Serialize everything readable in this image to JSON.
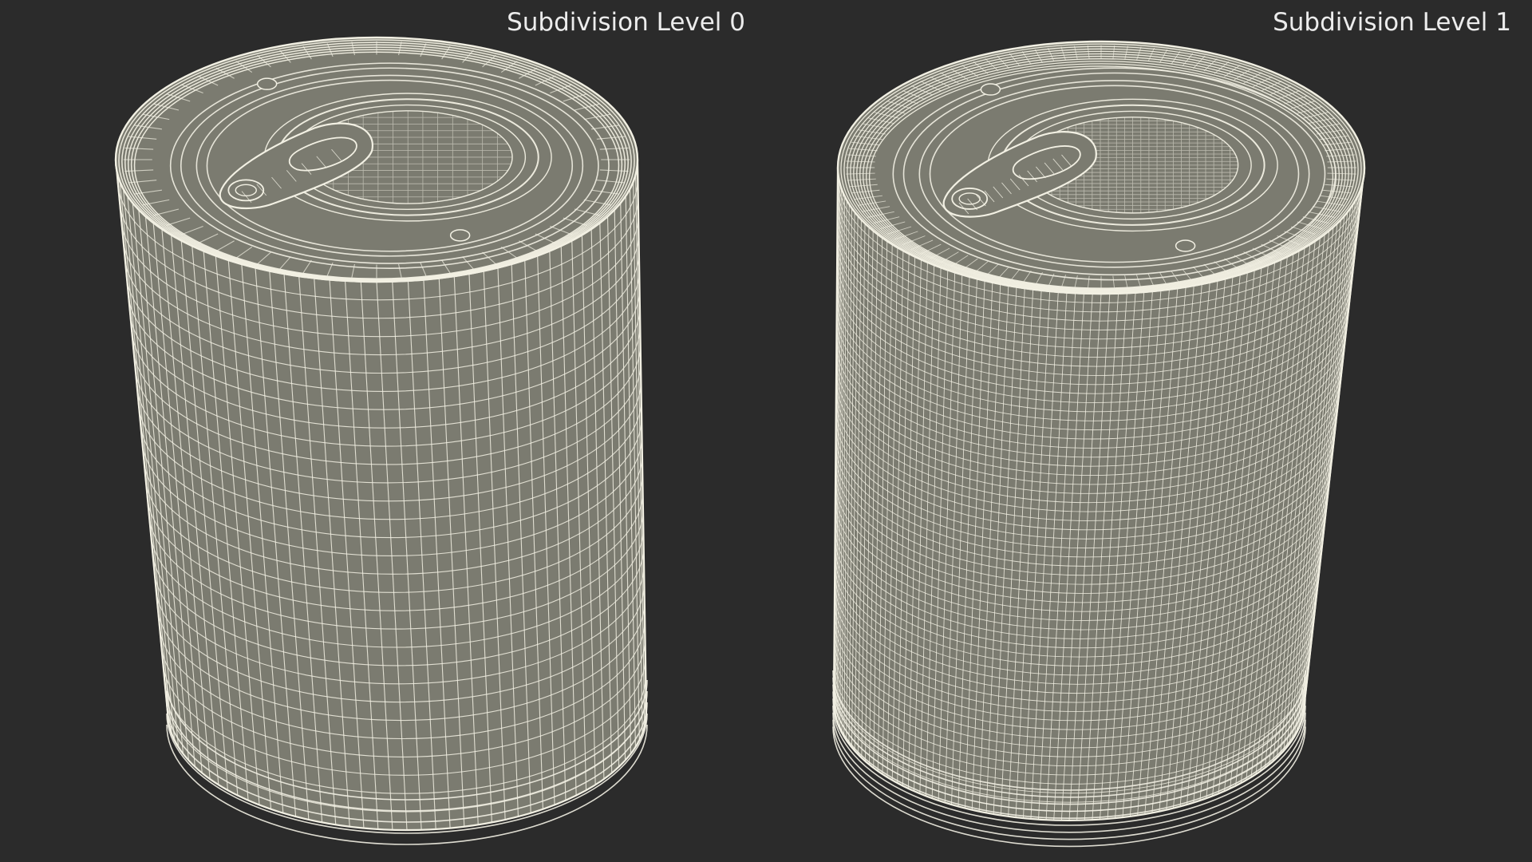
{
  "viewport": {
    "background_color": "#2b2b2b",
    "mesh_fill_color": "#7b7b70",
    "wire_color": "#f2f0e3"
  },
  "panels": [
    {
      "label": "Subdivision Level 0",
      "object": "can-with-pull-tab",
      "wire_density": "coarse"
    },
    {
      "label": "Subdivision Level 1",
      "object": "can-with-pull-tab",
      "wire_density": "fine"
    }
  ]
}
